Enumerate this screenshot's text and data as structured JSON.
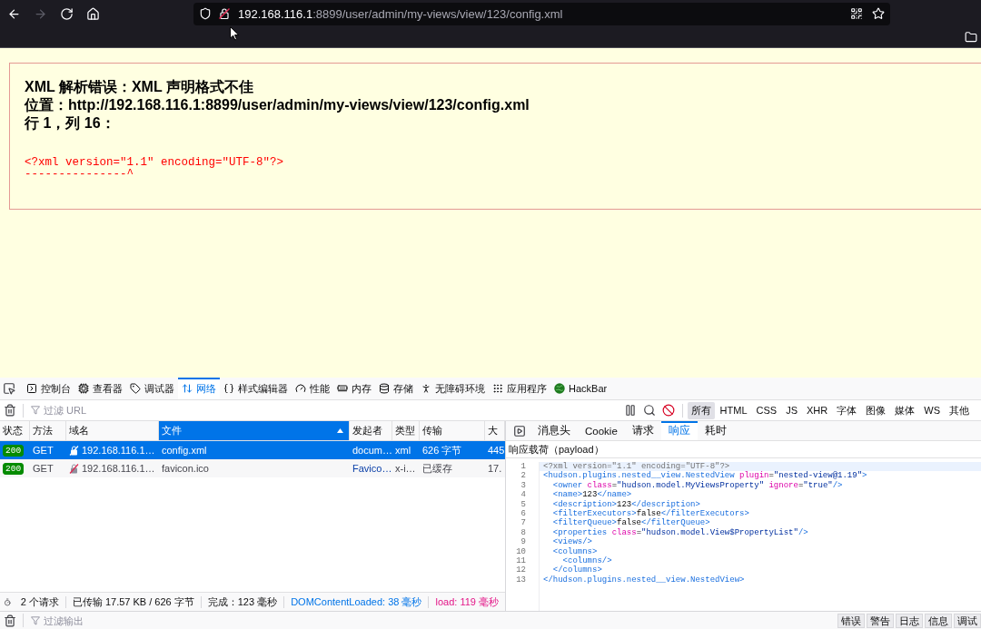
{
  "browser": {
    "url": {
      "host": "192.168.116.1",
      "rest": ":8899/user/admin/my-views/view/123/config.xml"
    }
  },
  "error": {
    "lines": [
      "XML 解析错误：XML 声明格式不佳",
      "位置：http://192.168.116.1:8899/user/admin/my-views/view/123/config.xml",
      "行 1，列 16："
    ],
    "source": "<?xml version=\"1.1\" encoding=\"UTF-8\"?>",
    "pointer": "---------------^"
  },
  "devtools": {
    "tools": [
      {
        "label": "控制台",
        "selected": false
      },
      {
        "label": "查看器",
        "selected": false
      },
      {
        "label": "调试器",
        "selected": false
      },
      {
        "label": "网络",
        "selected": true
      },
      {
        "label": "样式编辑器",
        "selected": false
      },
      {
        "label": "性能",
        "selected": false
      },
      {
        "label": "内存",
        "selected": false
      },
      {
        "label": "存储",
        "selected": false
      },
      {
        "label": "无障碍环境",
        "selected": false
      },
      {
        "label": "应用程序",
        "selected": false
      },
      {
        "label": "HackBar",
        "selected": false
      }
    ],
    "url_filter": {
      "placeholder": "过滤 URL"
    },
    "type_filters": [
      {
        "label": "所有",
        "selected": true
      },
      {
        "label": "HTML",
        "selected": false
      },
      {
        "label": "CSS",
        "selected": false
      },
      {
        "label": "JS",
        "selected": false
      },
      {
        "label": "XHR",
        "selected": false
      },
      {
        "label": "字体",
        "selected": false
      },
      {
        "label": "图像",
        "selected": false
      },
      {
        "label": "媒体",
        "selected": false
      },
      {
        "label": "WS",
        "selected": false
      },
      {
        "label": "其他",
        "selected": false
      }
    ],
    "requests": {
      "columns": [
        {
          "label": "状态",
          "sorted": false
        },
        {
          "label": "方法",
          "sorted": false
        },
        {
          "label": "域名",
          "sorted": false
        },
        {
          "label": "文件",
          "sorted": true
        },
        {
          "label": "发起者",
          "sorted": false
        },
        {
          "label": "类型",
          "sorted": false
        },
        {
          "label": "传输",
          "sorted": false
        },
        {
          "label": "大",
          "sorted": false
        }
      ],
      "rows": [
        {
          "selected": true,
          "cells": [
            "200",
            "GET",
            "192.168.116.1…",
            "config.xml",
            "docum…",
            "xml",
            "626 字节",
            "445"
          ]
        },
        {
          "selected": false,
          "cells": [
            "200",
            "GET",
            "192.168.116.1…",
            "favicon.ico",
            "Favico…",
            "x-i…",
            "已缓存",
            "17."
          ]
        }
      ]
    },
    "summary": [
      {
        "kind": "plain",
        "text": "2 个请求"
      },
      {
        "kind": "plain",
        "text": "已传输 17.57 KB / 626 字节"
      },
      {
        "kind": "plain",
        "text": "完成：123 毫秒"
      },
      {
        "kind": "domcontentloaded",
        "text": "DOMContentLoaded: 38 毫秒"
      },
      {
        "kind": "load",
        "text": "load: 119 毫秒"
      }
    ],
    "details": {
      "tabs": [
        {
          "label": "消息头",
          "selected": false
        },
        {
          "label": "Cookie",
          "selected": false
        },
        {
          "label": "请求",
          "selected": false
        },
        {
          "label": "响应",
          "selected": true
        },
        {
          "label": "耗时",
          "selected": false
        }
      ],
      "section": "响应载荷（payload）",
      "lines": [
        {
          "number": "1",
          "highlighted": true,
          "tokens": [
            {
              "kind": "prolog",
              "text": "<?xml version=\"1.1\" encoding=\"UTF-8\"?>"
            }
          ]
        },
        {
          "number": "2",
          "highlighted": false,
          "tokens": [
            {
              "kind": "tag",
              "text": "<hudson.plugins.nested__view.NestedView "
            },
            {
              "kind": "attr",
              "text": "plugin"
            },
            {
              "kind": "text",
              "text": "="
            },
            {
              "kind": "value",
              "text": "\"nested-view@1.19\""
            },
            {
              "kind": "tag",
              "text": ">"
            }
          ]
        },
        {
          "number": "3",
          "highlighted": false,
          "tokens": [
            {
              "kind": "tag",
              "text": "  <owner "
            },
            {
              "kind": "attr",
              "text": "class"
            },
            {
              "kind": "text",
              "text": "="
            },
            {
              "kind": "value",
              "text": "\"hudson.model.MyViewsProperty\" "
            },
            {
              "kind": "attr",
              "text": "ignore"
            },
            {
              "kind": "text",
              "text": "="
            },
            {
              "kind": "value",
              "text": "\"true\""
            },
            {
              "kind": "tag",
              "text": "/>"
            }
          ]
        },
        {
          "number": "4",
          "highlighted": false,
          "tokens": [
            {
              "kind": "tag",
              "text": "  <name>"
            },
            {
              "kind": "text",
              "text": "123"
            },
            {
              "kind": "tag",
              "text": "</name>"
            }
          ]
        },
        {
          "number": "5",
          "highlighted": false,
          "tokens": [
            {
              "kind": "tag",
              "text": "  <description>"
            },
            {
              "kind": "text",
              "text": "123"
            },
            {
              "kind": "tag",
              "text": "</description>"
            }
          ]
        },
        {
          "number": "6",
          "highlighted": false,
          "tokens": [
            {
              "kind": "tag",
              "text": "  <filterExecutors>"
            },
            {
              "kind": "text",
              "text": "false"
            },
            {
              "kind": "tag",
              "text": "</filterExecutors>"
            }
          ]
        },
        {
          "number": "7",
          "highlighted": false,
          "tokens": [
            {
              "kind": "tag",
              "text": "  <filterQueue>"
            },
            {
              "kind": "text",
              "text": "false"
            },
            {
              "kind": "tag",
              "text": "</filterQueue>"
            }
          ]
        },
        {
          "number": "8",
          "highlighted": false,
          "tokens": [
            {
              "kind": "tag",
              "text": "  <properties "
            },
            {
              "kind": "attr",
              "text": "class"
            },
            {
              "kind": "text",
              "text": "="
            },
            {
              "kind": "value",
              "text": "\"hudson.model.View$PropertyList\""
            },
            {
              "kind": "tag",
              "text": "/>"
            }
          ]
        },
        {
          "number": "9",
          "highlighted": false,
          "tokens": [
            {
              "kind": "tag",
              "text": "  <views/>"
            }
          ]
        },
        {
          "number": "10",
          "highlighted": false,
          "tokens": [
            {
              "kind": "tag",
              "text": "  <columns>"
            }
          ]
        },
        {
          "number": "11",
          "highlighted": false,
          "tokens": [
            {
              "kind": "tag",
              "text": "    <columns/>"
            }
          ]
        },
        {
          "number": "12",
          "highlighted": false,
          "tokens": [
            {
              "kind": "tag",
              "text": "  </columns>"
            }
          ]
        },
        {
          "number": "13",
          "highlighted": false,
          "tokens": [
            {
              "kind": "tag",
              "text": "</hudson.plugins.nested__view.NestedView>"
            }
          ]
        }
      ]
    },
    "console": {
      "placeholder": "过滤输出",
      "levels": [
        "错误",
        "警告",
        "日志",
        "信息",
        "调试"
      ]
    }
  }
}
